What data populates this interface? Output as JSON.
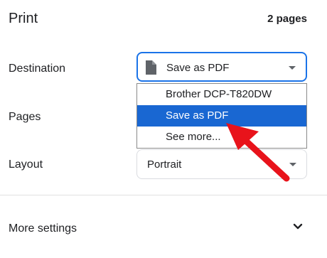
{
  "header": {
    "title": "Print",
    "page_count": "2 pages"
  },
  "destination": {
    "label": "Destination",
    "selected": "Save as PDF",
    "options": [
      "Brother DCP-T820DW",
      "Save as PDF",
      "See more..."
    ],
    "highlighted_index": 1
  },
  "pages": {
    "label": "Pages"
  },
  "layout": {
    "label": "Layout",
    "selected": "Portrait"
  },
  "more_settings": {
    "label": "More settings"
  },
  "colors": {
    "accent": "#1a73e8",
    "highlight": "#1967d2",
    "annotation_arrow": "#e8131b"
  },
  "icons": {
    "destination_icon": "document-icon",
    "dropdown_caret": "caret-down-icon",
    "expand": "chevron-down-icon"
  }
}
